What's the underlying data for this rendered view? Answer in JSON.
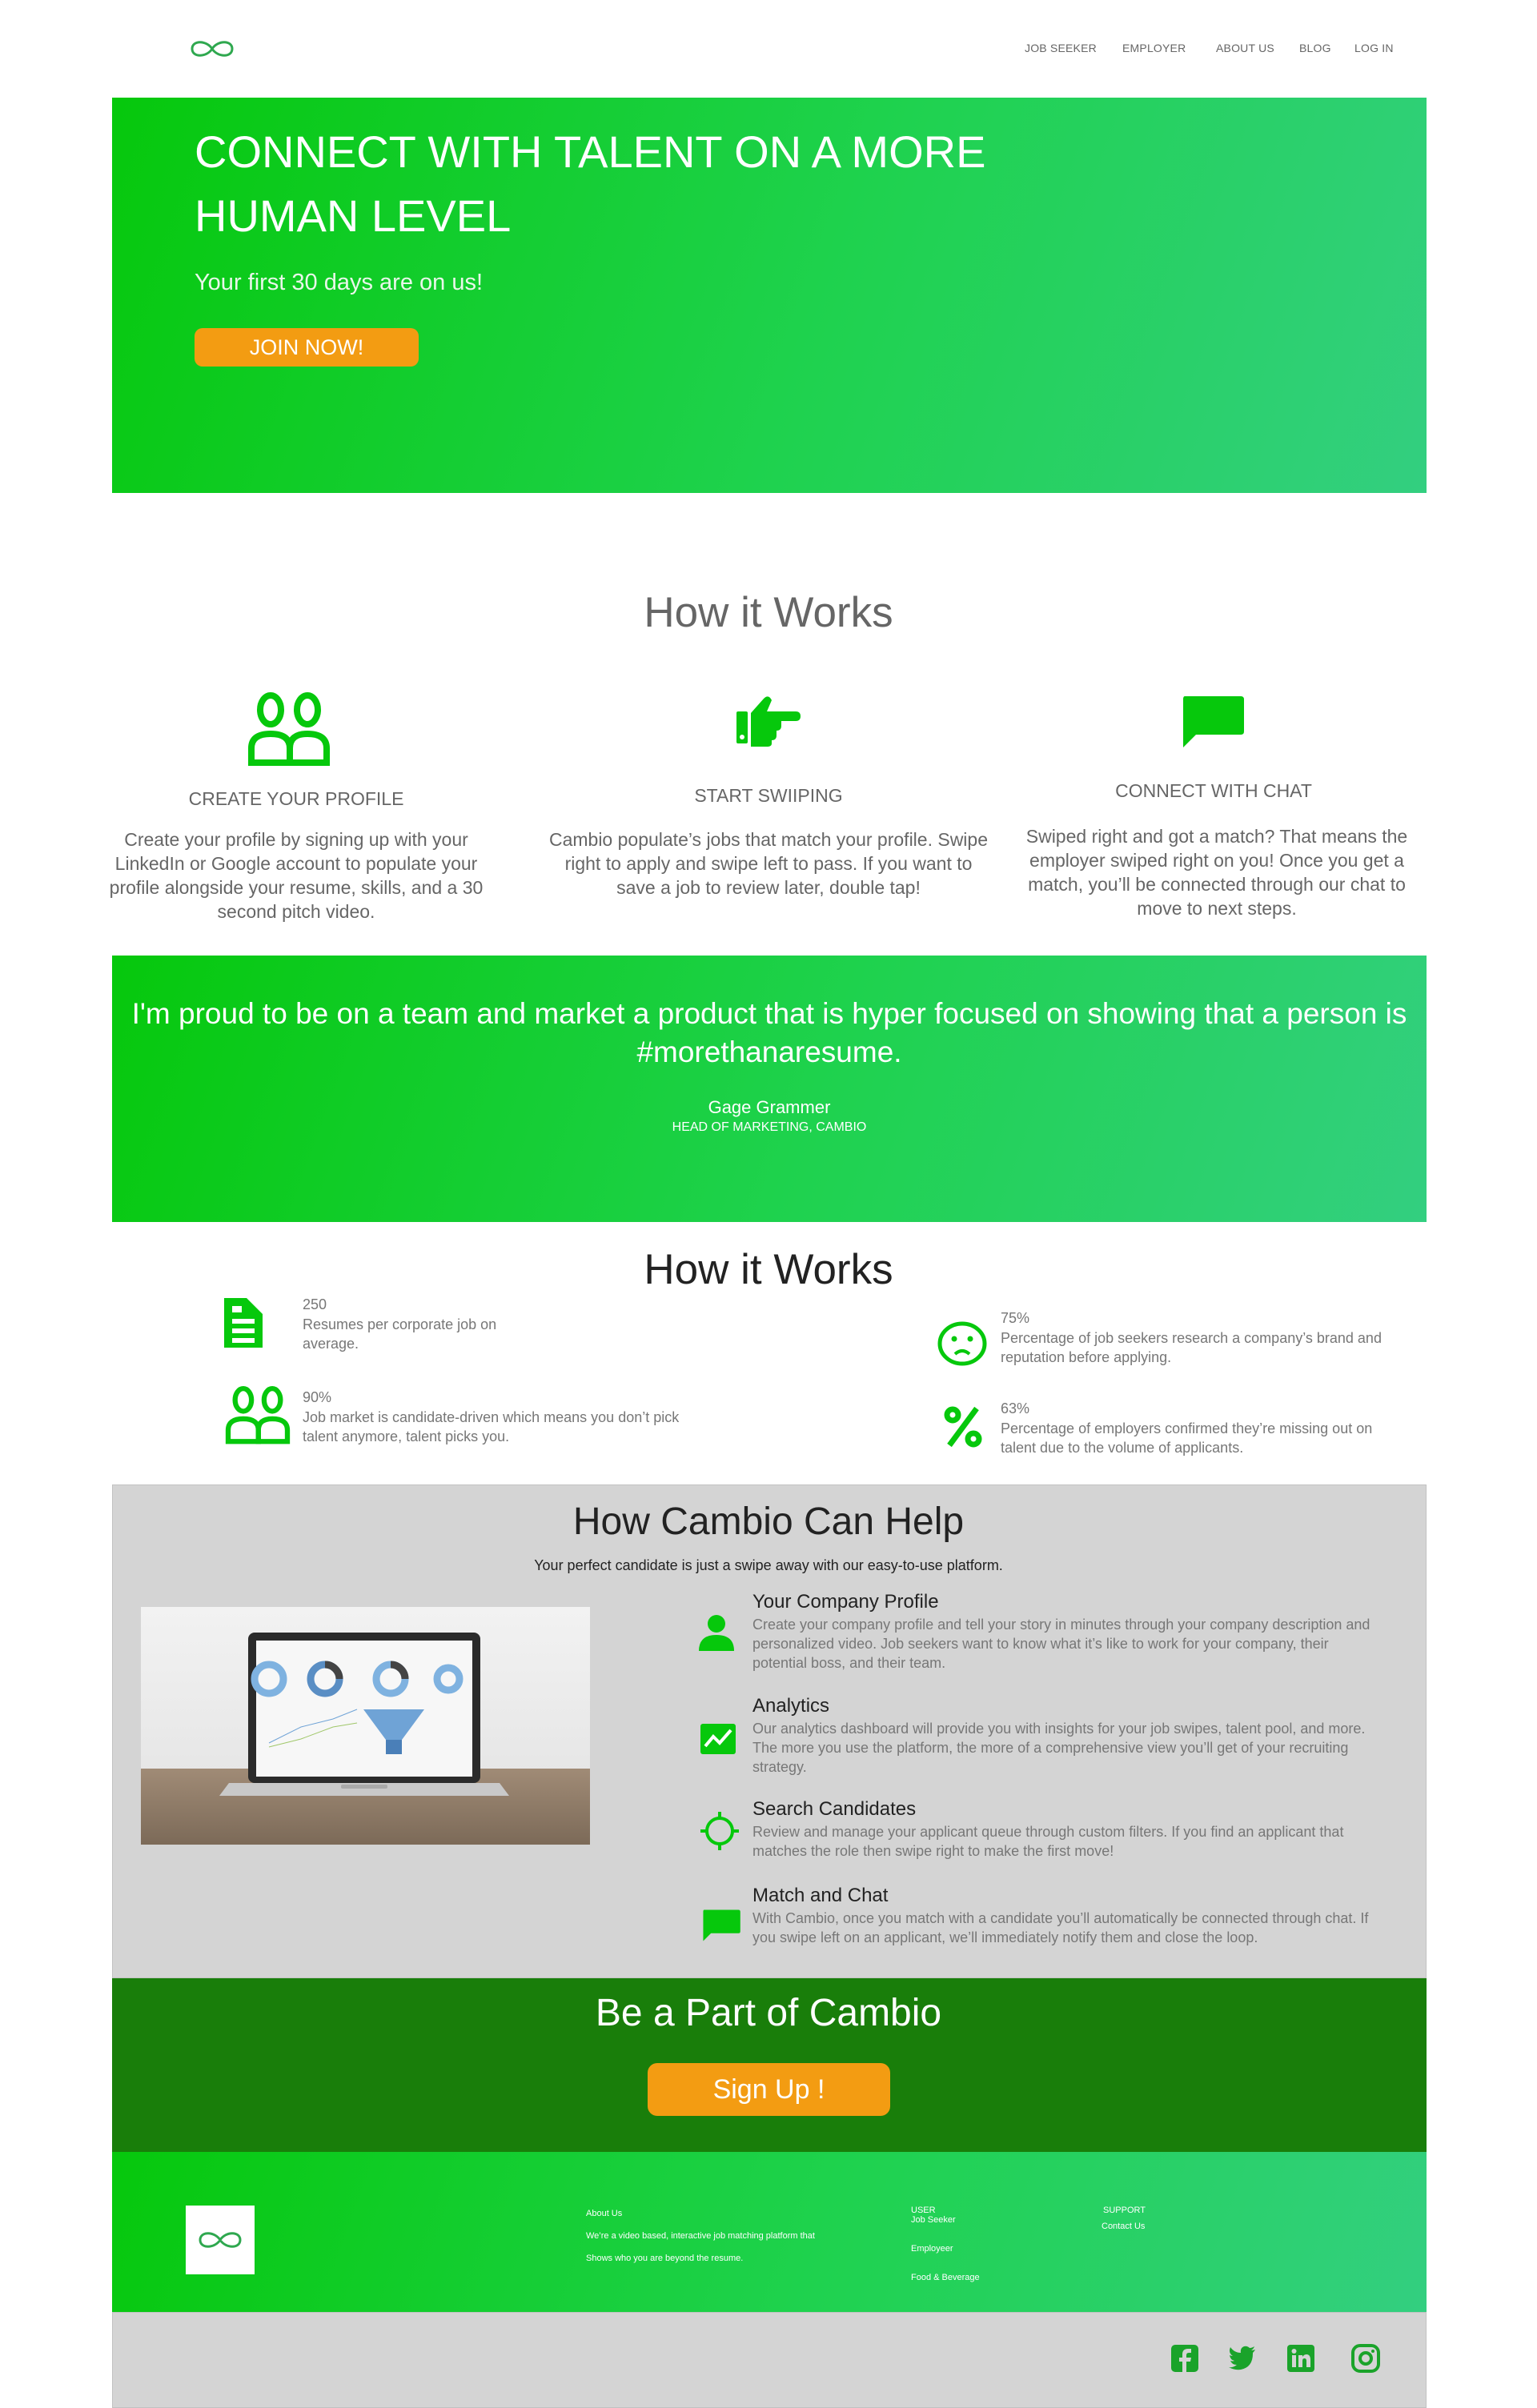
{
  "colors": {
    "brand_green": "#06c80c",
    "brand_teal": "#33cf80",
    "accent_orange": "#f39c12",
    "dark_green": "#197e0a",
    "panel_grey": "#d4d4d4"
  },
  "nav": {
    "logo": "infinity-logo",
    "items": [
      "JOB SEEKER",
      "EMPLOYER",
      "ABOUT US",
      "BLOG",
      "LOG IN"
    ]
  },
  "hero": {
    "title": "CONNECT WITH TALENT ON A MORE HUMAN LEVEL",
    "subtitle": "Your first 30 days are on us!",
    "cta": "JOIN NOW!"
  },
  "how_it_works": {
    "title": "How it Works",
    "steps": [
      {
        "icon": "people-icon",
        "title": "CREATE YOUR PROFILE",
        "desc": "Create your profile by signing up with your LinkedIn or Google account to populate your profile alongside your resume, skills, and a 30 second pitch video."
      },
      {
        "icon": "pointing-hand-icon",
        "title": "START SWIIPING",
        "desc": "Cambio populate’s jobs that match your profile. Swipe right to apply and swipe left to pass. If you want to save a job to review later, double tap!"
      },
      {
        "icon": "chat-bubble-icon",
        "title": "CONNECT WITH CHAT",
        "desc": "Swiped right and got a match? That means the employer swiped right on you! Once you get a match, you’ll be connected through our chat to move to next steps."
      }
    ]
  },
  "quote": {
    "text": "I'm proud to be on a team and market a product that is hyper focused on showing that a person is #morethanaresume.",
    "name": "Gage Grammer",
    "role": "HEAD OF MARKETING, CAMBIO"
  },
  "stats": {
    "title": "How it Works",
    "items": [
      {
        "icon": "document-icon",
        "value": "250",
        "desc": "Resumes per corporate job on average."
      },
      {
        "icon": "people-icon",
        "value": "90%",
        "desc": "Job market is candidate-driven which means you don’t pick talent anymore, talent picks you."
      },
      {
        "icon": "sad-face-icon",
        "value": "75%",
        "desc": "Percentage of job seekers research a company’s brand and reputation before applying."
      },
      {
        "icon": "percent-icon",
        "value": "63%",
        "desc": "Percentage of employers confirmed they’re missing out on talent due to the volume of applicants."
      }
    ]
  },
  "help": {
    "title": "How Cambio Can Help",
    "subtitle": "Your perfect candidate is just a swipe away with our easy-to-use platform.",
    "features": [
      {
        "icon": "person-icon",
        "title": "Your Company Profile",
        "desc": "Create your company profile and tell your story in minutes through your company description and personalized video. Job seekers want to know what it’s like to work for your company, their potential boss, and their team."
      },
      {
        "icon": "analytics-icon",
        "title": "Analytics",
        "desc": "Our analytics dashboard will provide you with insights for your job swipes, talent pool, and more. The more you use the platform, the more of a comprehensive view you’ll get of your recruiting strategy."
      },
      {
        "icon": "crosshair-icon",
        "title": "Search Candidates",
        "desc": "Review and manage your applicant queue through custom filters. If you find an applicant that matches the role then swipe right to make the first move!"
      },
      {
        "icon": "chat-bubble-icon",
        "title": "Match and Chat",
        "desc": "With Cambio, once you match with a candidate you’ll automatically be connected through chat. If you swipe left on an applicant, we’ll immediately notify them and close the loop."
      }
    ]
  },
  "cta": {
    "title": "Be a Part of Cambio",
    "button": "Sign Up !"
  },
  "footer": {
    "about_title": "About Us",
    "about_line1": "We’re a video based, interactive job matching platform that",
    "about_line2": "Shows who you are beyond the resume.",
    "user_title": "USER",
    "user_links": [
      "Job Seeker",
      "Employeer",
      "Food & Beverage"
    ],
    "support_title": "SUPPORT",
    "support_links": [
      "Contact Us"
    ]
  },
  "social": [
    "facebook-icon",
    "twitter-icon",
    "linkedin-icon",
    "instagram-icon"
  ]
}
